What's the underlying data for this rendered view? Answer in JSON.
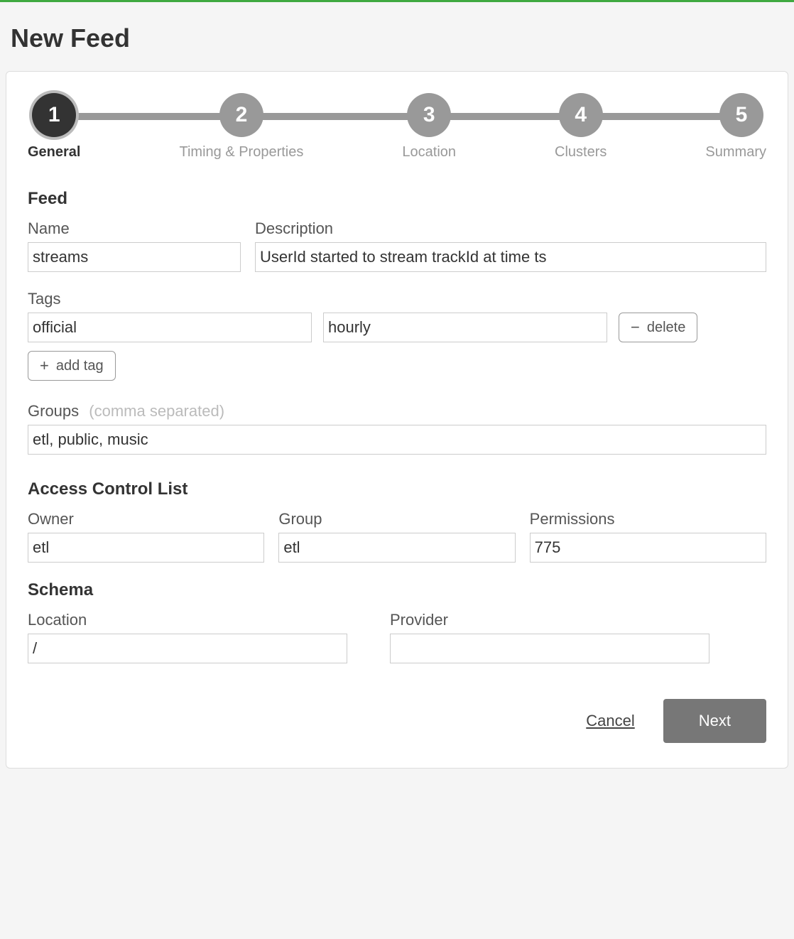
{
  "header": {
    "title": "New Feed"
  },
  "stepper": {
    "steps": [
      {
        "num": "1",
        "label": "General",
        "active": true
      },
      {
        "num": "2",
        "label": "Timing & Properties",
        "active": false
      },
      {
        "num": "3",
        "label": "Location",
        "active": false
      },
      {
        "num": "4",
        "label": "Clusters",
        "active": false
      },
      {
        "num": "5",
        "label": "Summary",
        "active": false
      }
    ]
  },
  "feed": {
    "section_title": "Feed",
    "name_label": "Name",
    "name_value": "streams",
    "description_label": "Description",
    "description_value": "UserId started to stream trackId at time ts",
    "tags_label": "Tags",
    "tags": [
      "official",
      "hourly"
    ],
    "delete_label": "delete",
    "add_tag_label": "add tag",
    "groups_label": "Groups",
    "groups_hint": "(comma separated)",
    "groups_value": "etl, public, music"
  },
  "acl": {
    "section_title": "Access Control List",
    "owner_label": "Owner",
    "owner_value": "etl",
    "group_label": "Group",
    "group_value": "etl",
    "permissions_label": "Permissions",
    "permissions_value": "775"
  },
  "schema": {
    "section_title": "Schema",
    "location_label": "Location",
    "location_value": "/",
    "provider_label": "Provider",
    "provider_value": ""
  },
  "actions": {
    "cancel": "Cancel",
    "next": "Next"
  }
}
